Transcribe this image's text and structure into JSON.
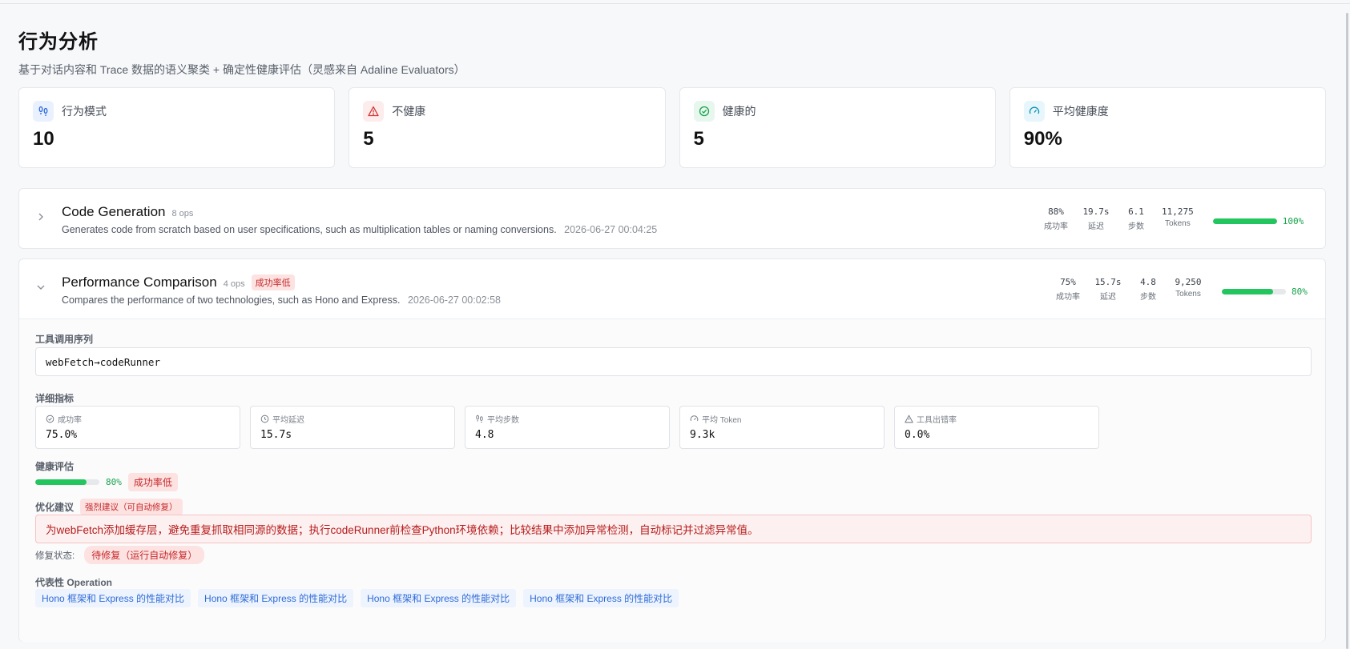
{
  "header": {
    "title": "行为分析",
    "subtitle": "基于对话内容和 Trace 数据的语义聚类 + 确定性健康评估（灵感来自 Adaline Evaluators）"
  },
  "stats": [
    {
      "label": "行为模式",
      "value": "10",
      "icon": "footprints-icon",
      "color": "#2f6bd8"
    },
    {
      "label": "不健康",
      "value": "5",
      "icon": "warning-triangle-icon",
      "color": "#d32f2f"
    },
    {
      "label": "健康的",
      "value": "5",
      "icon": "check-circle-icon",
      "color": "#16a34a"
    },
    {
      "label": "平均健康度",
      "value": "90%",
      "icon": "gauge-icon",
      "color": "#0891b2"
    }
  ],
  "patterns": [
    {
      "title": "Code Generation",
      "ops": "8 ops",
      "description": "Generates code from scratch based on user specifications, such as multiplication tables or naming conversions.",
      "timestamp": "2026-06-27 00:04:25",
      "metrics": [
        {
          "value": "88%",
          "label": "成功率"
        },
        {
          "value": "19.7s",
          "label": "延迟"
        },
        {
          "value": "6.1",
          "label": "步数"
        },
        {
          "value": "11,275",
          "label": "Tokens"
        }
      ],
      "health": 1.0,
      "health_text": "100%",
      "expanded": false
    },
    {
      "title": "Performance Comparison",
      "ops": "4 ops",
      "badge": "成功率低",
      "description": "Compares the performance of two technologies, such as Hono and Express.",
      "timestamp": "2026-06-27 00:02:58",
      "metrics": [
        {
          "value": "75%",
          "label": "成功率"
        },
        {
          "value": "15.7s",
          "label": "延迟"
        },
        {
          "value": "4.8",
          "label": "步数"
        },
        {
          "value": "9,250",
          "label": "Tokens"
        }
      ],
      "health": 0.8,
      "health_text": "80%",
      "expanded": true
    }
  ],
  "detail": {
    "tool_seq_label": "工具调用序列",
    "tool_seq": "webFetch→codeRunner",
    "metrics_label": "详细指标",
    "metrics": [
      {
        "label": "成功率",
        "value": "75.0%",
        "icon": "check-circle-icon"
      },
      {
        "label": "平均延迟",
        "value": "15.7s",
        "icon": "clock-icon"
      },
      {
        "label": "平均步数",
        "value": "4.8",
        "icon": "footprints-icon"
      },
      {
        "label": "平均 Token",
        "value": "9.3k",
        "icon": "gauge-icon"
      },
      {
        "label": "工具出错率",
        "value": "0.0%",
        "icon": "warning-triangle-icon"
      }
    ],
    "health_label": "健康评估",
    "health": 0.8,
    "health_text": "80%",
    "health_tag": "成功率低",
    "opt_label": "优化建议",
    "opt_tag": "强烈建议（可自动修复）",
    "opt_text": "为webFetch添加缓存层，避免重复抓取相同源的数据；执行codeRunner前检查Python环境依赖；比较结果中添加异常检测，自动标记并过滤异常值。",
    "fix_label": "修复状态:",
    "fix_status": "待修复（运行自动修复）",
    "ops_label": "代表性 Operation",
    "ops": [
      "Hono 框架和 Express 的性能对比",
      "Hono 框架和 Express 的性能对比",
      "Hono 框架和 Express 的性能对比",
      "Hono 框架和 Express 的性能对比"
    ]
  }
}
